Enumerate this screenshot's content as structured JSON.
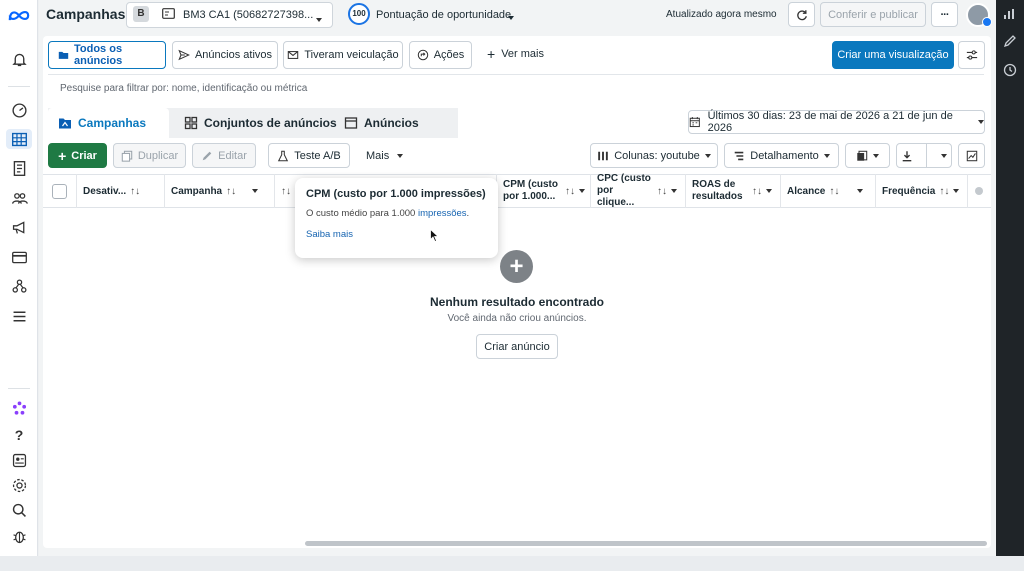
{
  "header": {
    "title": "Campanhas",
    "account_badge": "B",
    "account_name": "BM3 CA1 (50682727398...",
    "opportunity_score": "100",
    "opportunity_label": "Pontuação de oportunidade",
    "updated_text": "Atualizado agora mesmo",
    "review_publish": "Conferir e publicar",
    "more": "···"
  },
  "filters": {
    "all_ads": "Todos os anúncios",
    "active_ads": "Anúncios ativos",
    "had_delivery": "Tiveram veiculação",
    "actions": "Ações",
    "see_more": "Ver mais",
    "create_view": "Criar uma visualização",
    "search_placeholder": "Pesquise para filtrar por: nome, identificação ou métrica"
  },
  "tabs": {
    "campaigns": "Campanhas",
    "ad_sets": "Conjuntos de anúncios",
    "ads": "Anúncios"
  },
  "date_range": "Últimos 30 dias: 23 de mai de 2026 a 21 de jun de 2026",
  "toolbar": {
    "create": "Criar",
    "duplicate": "Duplicar",
    "edit": "Editar",
    "ab_test": "Teste A/B",
    "more": "Mais",
    "columns": "Colunas: youtube",
    "breakdown": "Detalhamento"
  },
  "columns": [
    {
      "label": "Desativ...",
      "sort": "↑↓"
    },
    {
      "label": "Campanha",
      "sort": "↑↓"
    },
    {
      "label": "",
      "sort": "↑↓"
    },
    {
      "label": "CPM (custo por 1.000...",
      "sort": "↑↓"
    },
    {
      "label": "CPC (custo por clique...",
      "sort": "↑↓"
    },
    {
      "label": "ROAS de resultados",
      "sort": "↑↓"
    },
    {
      "label": "Alcance",
      "sort": "↑↓"
    },
    {
      "label": "Frequência",
      "sort": "↑↓"
    }
  ],
  "tooltip": {
    "title": "CPM (custo por 1.000 impressões)",
    "body_prefix": "O custo médio para 1.000 ",
    "body_link": "impressões",
    "body_suffix": ".",
    "learn_more": "Saiba mais"
  },
  "empty_state": {
    "title": "Nenhum resultado encontrado",
    "subtitle": "Você ainda não criou anúncios.",
    "create_ad": "Criar anúncio"
  },
  "colors": {
    "primary": "#0a78be",
    "create_green": "#1f7a44"
  }
}
